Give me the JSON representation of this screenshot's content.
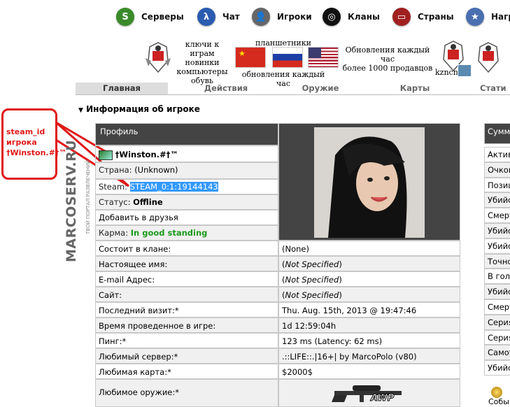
{
  "nav": [
    {
      "label": "Серверы",
      "icon": "servers-icon",
      "color": "#3a8a2a"
    },
    {
      "label": "Чат",
      "icon": "chat-icon",
      "color": "#2a5bb0"
    },
    {
      "label": "Игроки",
      "icon": "players-icon",
      "color": "#555555"
    },
    {
      "label": "Кланы",
      "icon": "clans-icon",
      "color": "#222222"
    },
    {
      "label": "Страны",
      "icon": "countries-icon",
      "color": "#a02020"
    },
    {
      "label": "Нагр",
      "icon": "awards-icon",
      "color": "#4a6fb0"
    }
  ],
  "ads": {
    "block1": [
      "ключи к играм",
      "новинки",
      "компьютеры",
      "обувь"
    ],
    "tablets_top": "планшетники",
    "tablets_bottom": "обновления каждый час",
    "block3": [
      "Обновления каждый час",
      "более 1000 продавцов"
    ],
    "domain": "kzncn"
  },
  "tabs": [
    "Главная",
    "Действия",
    "Оружие",
    "Карты",
    "Стати"
  ],
  "section_title": "Информация об игроке",
  "annotation": {
    "line1": "steam_id",
    "line2": "игрока",
    "line3": "†Winston.#†™"
  },
  "watermark": {
    "main": "MARCOSERV.RU",
    "sub": "ТВОЙ ПОРТАЛ РАЗВЛЕЧЕНИЙ"
  },
  "profile": {
    "header": "Профиль",
    "name": "†Winston.#†™",
    "country_label": "Страна:",
    "country_value": "(Unknown)",
    "steam_label": "Steam:",
    "steam_value": "STEAM_0:1:19144143",
    "status_label": "Статус:",
    "status_value": "Offline",
    "add_friend": "Добавить в друзья",
    "karma_label": "Карма:",
    "karma_value": "In good standing"
  },
  "details": [
    {
      "label": "Состоит в клане:",
      "value": "(None)",
      "italic": false
    },
    {
      "label": "Настоящее имя:",
      "value": "Not Specified",
      "italic": true
    },
    {
      "label": "E-mail Адрес:",
      "value": "Not Specified",
      "italic": true
    },
    {
      "label": "Сайт:",
      "value": "Not Specified",
      "italic": true
    },
    {
      "label": "Последний визит:*",
      "value": "Thu. Aug. 15th, 2013 @ 19:47:46",
      "italic": false
    },
    {
      "label": "Время проведенное в игре:",
      "value": "1d 12:59:04h",
      "italic": false
    },
    {
      "label": "Пинг:*",
      "value": "123 ms (Latency: 62 ms)",
      "italic": false
    },
    {
      "label": "Любимый сервер:*",
      "value": ".::LIFE::.|16+| by MarcoPolo (v80)",
      "italic": false
    },
    {
      "label": "Любимая карта:*",
      "value": "$2000$",
      "italic": false
    },
    {
      "label": "Любимое оружие:*",
      "value": "",
      "italic": false
    }
  ],
  "weapon_label": "AWP",
  "summary": {
    "header": "Сумма",
    "rows": [
      "Актив",
      "Очков",
      "Позиц",
      "Убийс",
      "Смерт",
      "Убийс",
      "Убийс",
      "Точно",
      "В голо",
      "Убийс",
      "Смерт",
      "Серия",
      "Серия",
      "Самоу",
      "Убийс"
    ],
    "footer": "Собы"
  }
}
